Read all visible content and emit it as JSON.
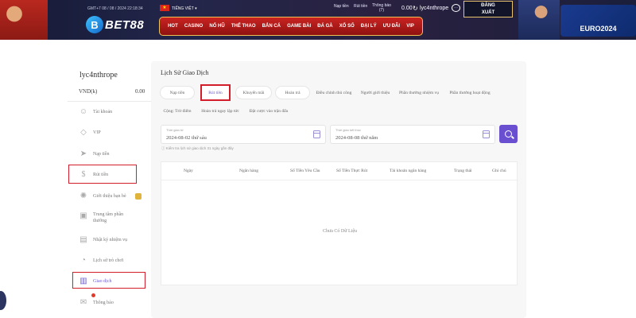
{
  "header": {
    "datetime": "GMT+7 08 / 08 / 2024 22:18:34",
    "language": "TIẾNG VIỆT ▾",
    "deposit": "Nạp tiền",
    "withdraw": "Rút tiền",
    "notifications": "Thông báo",
    "notif_count": "(7)",
    "balance": "0.00",
    "username": "lyc4nthrope",
    "logout_line1": "ĐĂNG",
    "logout_line2": "XUẤT",
    "logo": "BET88",
    "euro_badge": "EURO2024"
  },
  "nav": [
    "HOT",
    "CASINO",
    "NỔ HŨ",
    "THỂ THAO",
    "BẮN CÁ",
    "GAME BÀI",
    "ĐÁ GÀ",
    "XỔ SỐ",
    "ĐẠI LÝ",
    "ƯU ĐÃI",
    "VIP"
  ],
  "sidebar": {
    "username": "lyc4nthrope",
    "currency_label": "VND(k)",
    "currency_value": "0.00",
    "items": [
      {
        "label": "Tài khoản",
        "icon": "user-icon"
      },
      {
        "label": "VIP",
        "icon": "diamond-icon"
      },
      {
        "label": "Nạp tiền",
        "icon": "send-icon"
      },
      {
        "label": "Rút tiền",
        "icon": "cash-icon"
      },
      {
        "label": "Giới thiệu bạn bè",
        "icon": "bulb-icon"
      },
      {
        "label": "Trung tâm phần thưởng",
        "icon": "gift-icon"
      },
      {
        "label": "Nhật ký nhiệm vụ",
        "icon": "clipboard-icon"
      },
      {
        "label": "Lịch sử trò chơi",
        "icon": "history-icon"
      },
      {
        "label": "Giao dịch",
        "icon": "receipt-icon"
      },
      {
        "label": "Thông báo",
        "icon": "mail-icon"
      }
    ]
  },
  "main": {
    "title": "Lịch Sử Giao Dịch",
    "tabs_row1": [
      "Nạp tiền",
      "Rút tiền",
      "Khuyến mãi",
      "Hoàn trả",
      "Điều chỉnh thủ công",
      "Người giới thiệu",
      "Phần thưởng nhiệm vụ",
      "Phần thưởng hoạt động"
    ],
    "tabs_row2": [
      "Cộng: Trừ điểm",
      "Hoàn trả ngay lập tức",
      "Đặt cược vào trận đấu"
    ],
    "start_label": "Thời gian từ",
    "start_value": "2024-08-02 thứ sáu",
    "end_label": "Thời gian kết thúc",
    "end_value": "2024-08-08 thứ năm",
    "note": "ⓘ Kiểm tra lịch sử giao dịch 31 ngày gần đây",
    "columns": [
      "Ngày",
      "Ngân hàng",
      "Số Tiền Yêu Cầu",
      "Số Tiền Thực Rút",
      "Tài khoản ngân hàng",
      "Trạng thái",
      "Ghi chú"
    ],
    "empty": "Chưa Có Dữ Liệu"
  },
  "colors": {
    "accent": "#6a4fd1",
    "nav_red": "#c92321",
    "highlight": "#d21e2b"
  }
}
